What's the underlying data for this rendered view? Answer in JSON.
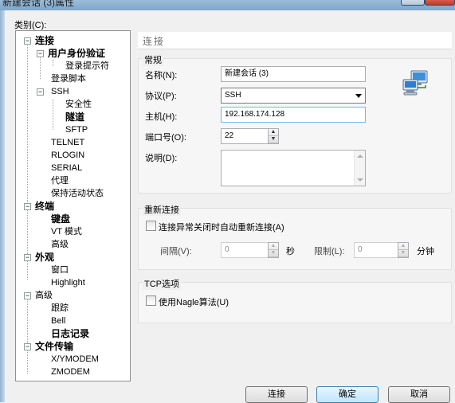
{
  "window": {
    "title": "新建会话 (3)属性"
  },
  "category": {
    "label": "类别(C):"
  },
  "tree": {
    "items": [
      {
        "label": "连接",
        "bold": true
      },
      {
        "label": "用户身份验证",
        "bold": true
      },
      {
        "label": "登录提示符",
        "bold": false
      },
      {
        "label": "登录脚本",
        "bold": false
      },
      {
        "label": "SSH",
        "bold": false
      },
      {
        "label": "安全性",
        "bold": false
      },
      {
        "label": "隧道",
        "bold": true
      },
      {
        "label": "SFTP",
        "bold": false
      },
      {
        "label": "TELNET",
        "bold": false
      },
      {
        "label": "RLOGIN",
        "bold": false
      },
      {
        "label": "SERIAL",
        "bold": false
      },
      {
        "label": "代理",
        "bold": false
      },
      {
        "label": "保持活动状态",
        "bold": false
      },
      {
        "label": "终端",
        "bold": true
      },
      {
        "label": "键盘",
        "bold": true
      },
      {
        "label": "VT 模式",
        "bold": false
      },
      {
        "label": "高级",
        "bold": false
      },
      {
        "label": "外观",
        "bold": true
      },
      {
        "label": "窗口",
        "bold": false
      },
      {
        "label": "Highlight",
        "bold": false
      },
      {
        "label": "高级",
        "bold": false
      },
      {
        "label": "跟踪",
        "bold": false
      },
      {
        "label": "Bell",
        "bold": false
      },
      {
        "label": "日志记录",
        "bold": true
      },
      {
        "label": "文件传输",
        "bold": true
      },
      {
        "label": "X/YMODEM",
        "bold": false
      },
      {
        "label": "ZMODEM",
        "bold": false
      }
    ]
  },
  "panel": {
    "header": "连接",
    "general": {
      "title": "常规",
      "name_label": "名称(N):",
      "name_value": "新建会话 (3)",
      "protocol_label": "协议(P):",
      "protocol_value": "SSH",
      "host_label": "主机(H):",
      "host_value": "192.168.174.128",
      "port_label": "端口号(O):",
      "port_value": "22",
      "desc_label": "说明(D):",
      "desc_value": ""
    },
    "reconnect": {
      "title": "重新连接",
      "checkbox_label": "连接异常关闭时自动重新连接(A)",
      "checked": false,
      "interval_label": "间隔(V):",
      "interval_value": "0",
      "interval_unit": "秒",
      "limit_label": "限制(L):",
      "limit_value": "0",
      "limit_unit": "分钟"
    },
    "tcp": {
      "title": "TCP选项",
      "nagle_label": "使用Nagle算法(U)",
      "checked": false
    }
  },
  "buttons": {
    "connect": "连接",
    "ok": "确定",
    "cancel": "取消"
  },
  "icons": {
    "network": "network-computers-icon"
  }
}
